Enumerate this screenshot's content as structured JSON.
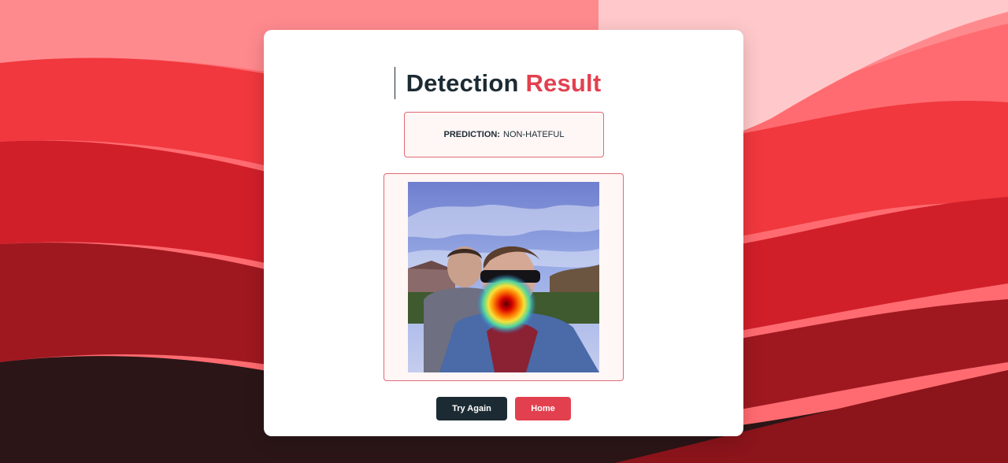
{
  "header": {
    "title_primary": "Detection",
    "title_accent": "Result"
  },
  "prediction": {
    "label": "PREDICTION:",
    "value": "NON-HATEFUL"
  },
  "actions": {
    "try_again_label": "Try Again",
    "home_label": "Home"
  },
  "colors": {
    "accent": "#e3404f",
    "dark": "#1c2b33",
    "panel_border": "#e06b75",
    "panel_bg": "#fff6f6"
  }
}
